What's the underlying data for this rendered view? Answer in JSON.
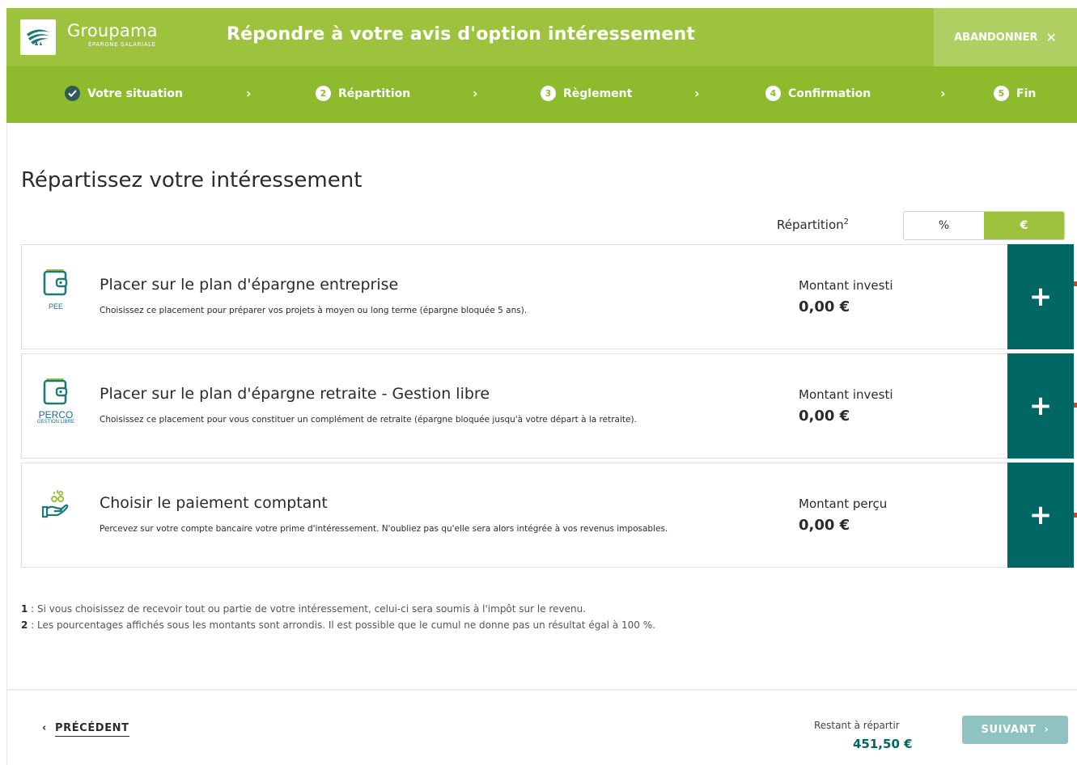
{
  "header": {
    "brand_name": "Groupama",
    "brand_sub": "ÉPARGNE SALARIALE",
    "title": "Répondre à votre avis d'option intéressement",
    "abandon_label": "ABANDONNER",
    "abandon_icon": "close-icon"
  },
  "steps": [
    {
      "label": "Votre situation",
      "marker": "check-icon",
      "state": "done"
    },
    {
      "label": "Répartition",
      "marker": "2",
      "state": "current"
    },
    {
      "label": "Règlement",
      "marker": "3",
      "state": "upcoming"
    },
    {
      "label": "Confirmation",
      "marker": "4",
      "state": "upcoming"
    },
    {
      "label": "Fin",
      "marker": "5",
      "state": "upcoming"
    }
  ],
  "main": {
    "heading": "Répartissez votre intéressement",
    "repartition_label": "Répartition",
    "repartition_sup": "2",
    "toggle": {
      "percent": "%",
      "euro": "€",
      "selected": "€"
    }
  },
  "cards": [
    {
      "icon": "wallet-icon",
      "icon_caption": "PEE",
      "title": "Placer sur le plan d'épargne entreprise",
      "description": "Choisissez ce placement pour préparer vos projets à moyen ou long terme (épargne bloquée 5 ans).",
      "amount_label": "Montant investi",
      "amount": "0,00 €"
    },
    {
      "icon": "wallet-icon",
      "icon_caption": "PERCO",
      "icon_caption_sub": "GESTION LIBRE",
      "title": "Placer sur le plan d'épargne retraite - Gestion libre",
      "description": "Choisissez ce placement pour vous constituer un complément de retraite (épargne bloquée jusqu'à votre départ à la retraite).",
      "amount_label": "Montant investi",
      "amount": "0,00 €"
    },
    {
      "icon": "hand-coins-icon",
      "title": "Choisir le paiement comptant",
      "description": "Percevez sur votre compte bancaire votre prime d'intéressement. N'oubliez pas qu'elle sera alors intégrée à vos revenus imposables.",
      "amount_label": "Montant perçu",
      "amount": "0,00 €"
    }
  ],
  "footnotes": [
    {
      "num": "1",
      "text": " : Si vous choisissez de recevoir tout ou partie de votre intéressement, celui-ci sera soumis à l'impôt sur le revenu."
    },
    {
      "num": "2",
      "text": " : Les pourcentages affichés sous les montants sont arrondis. Il est possible que le cumul ne donne pas un résultat égal à 100 %."
    }
  ],
  "footer": {
    "prev_label": "PRÉCÉDENT",
    "remaining_label": "Restant à répartir",
    "remaining_amount": "451,50 €",
    "next_label": "SUIVANT"
  },
  "colors": {
    "brand_green": "#9dc33e",
    "steps_green": "#8dbb2d",
    "teal": "#006764",
    "next_disabled": "#8fc3c1"
  }
}
